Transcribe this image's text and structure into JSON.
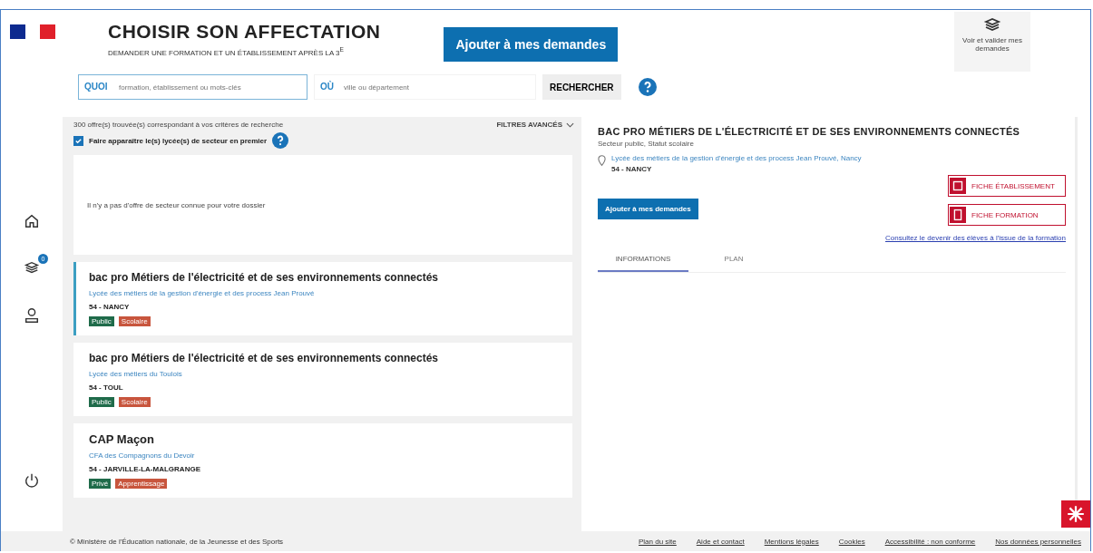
{
  "header": {
    "title": "CHOISIR SON AFFECTATION",
    "subtitle": "DEMANDER UNE FORMATION ET UN ÉTABLISSEMENT APRÈS LA 3$^{E}$",
    "add_button": "Ajouter à mes demandes",
    "requests_button": "Voir et valider mes demandes"
  },
  "search": {
    "what_label": "QUOI",
    "what_placeholder": "formation, établissement ou mots-clés",
    "where_label": "OÙ",
    "where_placeholder": "ville ou département",
    "button": "RECHERCHER"
  },
  "sidebar": {
    "items": [
      {
        "kind": "home"
      },
      {
        "kind": "requests",
        "badge": "0"
      },
      {
        "kind": "account"
      },
      {
        "kind": "logout"
      }
    ]
  },
  "results": {
    "count": "300 offre(s) trouvée(s) correspondant à vos critères de recherche",
    "filters": "FILTRES AVANCÉS",
    "sector_first": {
      "label": "Faire apparaître le(s) lycée(s) de secteur en premier",
      "checked": true
    },
    "empty_message": "Il n'y a pas d'offre de secteur connue pour votre dossier",
    "items": [
      {
        "title": "bac pro Métiers de l'électricité et de ses environnements connectés",
        "school": "Lycée des métiers de la gestion d'énergie et des process Jean Prouvé",
        "city": "54 - NANCY",
        "tags": [
          {
            "label": "Public",
            "color": "#1f6b4a"
          },
          {
            "label": "Scolaire",
            "color": "#c8553d"
          }
        ],
        "selected": true
      },
      {
        "title": "bac pro Métiers de l'électricité et de ses environnements connectés",
        "school": "Lycée des métiers du Toulois",
        "city": "54 - TOUL",
        "tags": [
          {
            "label": "Public",
            "color": "#1f6b4a"
          },
          {
            "label": "Scolaire",
            "color": "#c8553d"
          }
        ],
        "selected": false
      },
      {
        "title": "CAP Maçon",
        "school": "CFA des Compagnons du Devoir",
        "city": "54 - JARVILLE-LA-MALGRANGE",
        "tags": [
          {
            "label": "Privé",
            "color": "#1f6b4a"
          },
          {
            "label": "Apprentissage",
            "color": "#c8553d"
          }
        ],
        "selected": false
      }
    ]
  },
  "detail": {
    "title": "BAC PRO MÉTIERS DE L'ÉLECTRICITÉ ET DE SES ENVIRONNEMENTS CONNECTÉS",
    "subtitle": "Secteur public, Statut scolaire",
    "school": "Lycée des métiers de la gestion d'énergie et des process Jean Prouvé, Nancy",
    "city": "54 - NANCY",
    "add_button": "Ajouter à mes demandes",
    "school_sheet": "FICHE ÉTABLISSEMENT",
    "training_sheet": "FICHE FORMATION",
    "outcome_link": "Consultez le devenir des élèves à l'issue de la formation",
    "tabs": [
      {
        "label": "INFORMATIONS",
        "selected": true
      },
      {
        "label": "PLAN",
        "selected": false
      }
    ]
  },
  "footer": {
    "copyright": "© Ministère de l'Éducation nationale, de la Jeunesse et des Sports",
    "links": [
      "Plan du site",
      "Aide et contact",
      "Mentions légales",
      "Cookies",
      "Accessibilité : non conforme",
      "Nos données personnelles"
    ]
  }
}
